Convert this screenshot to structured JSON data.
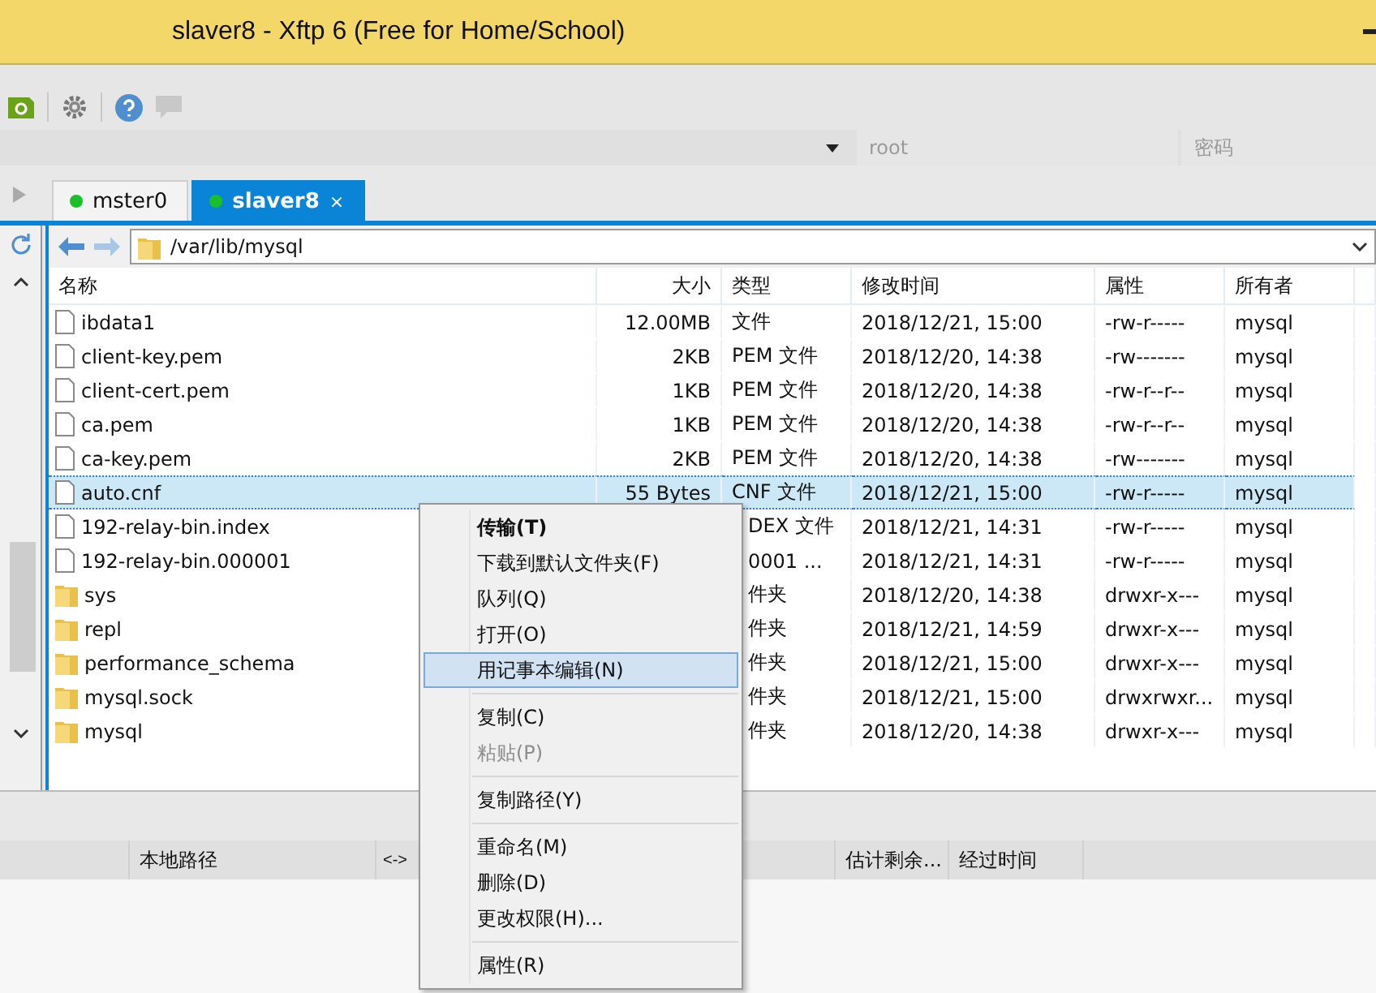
{
  "window": {
    "title": "slaver8 - Xftp 6 (Free for Home/School)"
  },
  "login": {
    "user_placeholder": "root",
    "password_placeholder": "密码"
  },
  "tabs": [
    {
      "label": "mster0",
      "selected": false
    },
    {
      "label": "slaver8",
      "selected": true,
      "close": "×"
    }
  ],
  "path": "/var/lib/mysql",
  "columns": [
    "名称",
    "大小",
    "类型",
    "修改时间",
    "属性",
    "所有者"
  ],
  "rows": [
    {
      "kind": "file",
      "name": "ibdata1",
      "size": "12.00MB",
      "type": "文件",
      "modified": "2018/12/21, 15:00",
      "attr": "-rw-r-----",
      "owner": "mysql",
      "selected": false
    },
    {
      "kind": "file",
      "name": "client-key.pem",
      "size": "2KB",
      "type": "PEM 文件",
      "modified": "2018/12/20, 14:38",
      "attr": "-rw-------",
      "owner": "mysql",
      "selected": false
    },
    {
      "kind": "file",
      "name": "client-cert.pem",
      "size": "1KB",
      "type": "PEM 文件",
      "modified": "2018/12/20, 14:38",
      "attr": "-rw-r--r--",
      "owner": "mysql",
      "selected": false
    },
    {
      "kind": "file",
      "name": "ca.pem",
      "size": "1KB",
      "type": "PEM 文件",
      "modified": "2018/12/20, 14:38",
      "attr": "-rw-r--r--",
      "owner": "mysql",
      "selected": false
    },
    {
      "kind": "file",
      "name": "ca-key.pem",
      "size": "2KB",
      "type": "PEM 文件",
      "modified": "2018/12/20, 14:38",
      "attr": "-rw-------",
      "owner": "mysql",
      "selected": false
    },
    {
      "kind": "file",
      "name": "auto.cnf",
      "size": "55 Bytes",
      "type": "CNF 文件",
      "modified": "2018/12/21, 15:00",
      "attr": "-rw-r-----",
      "owner": "mysql",
      "selected": true
    },
    {
      "kind": "file",
      "name": "192-relay-bin.index",
      "type": "DEX 文件",
      "modified": "2018/12/21, 14:31",
      "attr": "-rw-r-----",
      "owner": "mysql",
      "selected": false
    },
    {
      "kind": "file",
      "name": "192-relay-bin.000001",
      "type": "0001 ...",
      "modified": "2018/12/21, 14:31",
      "attr": "-rw-r-----",
      "owner": "mysql",
      "selected": false
    },
    {
      "kind": "folder",
      "name": "sys",
      "type": "件夹",
      "modified": "2018/12/20, 14:38",
      "attr": "drwxr-x---",
      "owner": "mysql",
      "selected": false
    },
    {
      "kind": "folder",
      "name": "repl",
      "type": "件夹",
      "modified": "2018/12/21, 14:59",
      "attr": "drwxr-x---",
      "owner": "mysql",
      "selected": false
    },
    {
      "kind": "folder",
      "name": "performance_schema",
      "type": "件夹",
      "modified": "2018/12/21, 15:00",
      "attr": "drwxr-x---",
      "owner": "mysql",
      "selected": false
    },
    {
      "kind": "folder",
      "name": "mysql.sock",
      "type": "件夹",
      "modified": "2018/12/21, 15:00",
      "attr": "drwxrwxr...",
      "owner": "mysql",
      "selected": false
    },
    {
      "kind": "folder",
      "name": "mysql",
      "type": "件夹",
      "modified": "2018/12/20, 14:38",
      "attr": "drwxr-x---",
      "owner": "mysql",
      "selected": false
    }
  ],
  "transfer_columns": [
    "本地路径",
    "<->",
    "估计剩余...",
    "经过时间"
  ],
  "context_menu": [
    {
      "kind": "item",
      "label": "传输(T)",
      "bold": true,
      "disabled": false,
      "selected": false
    },
    {
      "kind": "item",
      "label": "下载到默认文件夹(F)",
      "bold": false,
      "disabled": false,
      "selected": false
    },
    {
      "kind": "item",
      "label": "队列(Q)",
      "bold": false,
      "disabled": false,
      "selected": false
    },
    {
      "kind": "item",
      "label": "打开(O)",
      "bold": false,
      "disabled": false,
      "selected": false
    },
    {
      "kind": "item",
      "label": "用记事本编辑(N)",
      "bold": false,
      "disabled": false,
      "selected": true
    },
    {
      "kind": "separator"
    },
    {
      "kind": "item",
      "label": "复制(C)",
      "bold": false,
      "disabled": false,
      "selected": false
    },
    {
      "kind": "item",
      "label": "粘贴(P)",
      "bold": false,
      "disabled": true,
      "selected": false
    },
    {
      "kind": "separator"
    },
    {
      "kind": "item",
      "label": "复制路径(Y)",
      "bold": false,
      "disabled": false,
      "selected": false
    },
    {
      "kind": "separator"
    },
    {
      "kind": "item",
      "label": "重命名(M)",
      "bold": false,
      "disabled": false,
      "selected": false
    },
    {
      "kind": "item",
      "label": "删除(D)",
      "bold": false,
      "disabled": false,
      "selected": false
    },
    {
      "kind": "item",
      "label": "更改权限(H)...",
      "bold": false,
      "disabled": false,
      "selected": false
    },
    {
      "kind": "separator"
    },
    {
      "kind": "item",
      "label": "属性(R)",
      "bold": false,
      "disabled": false,
      "selected": false
    }
  ]
}
